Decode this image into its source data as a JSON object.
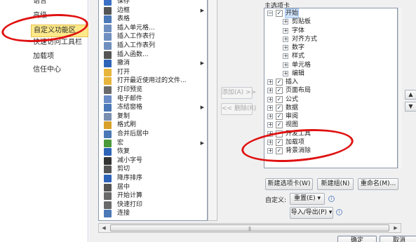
{
  "left_nav": {
    "items": [
      {
        "label": "语言"
      },
      {
        "label": "高级"
      },
      {
        "label": "自定义功能区"
      },
      {
        "label": "快速访问工具栏"
      },
      {
        "label": "加载项"
      },
      {
        "label": "信任中心"
      }
    ]
  },
  "commands": [
    {
      "label": "保存",
      "icon": "save-icon",
      "color": "#3a6fc4"
    },
    {
      "label": "边框",
      "icon": "border-icon",
      "color": "#555555",
      "arrow": true
    },
    {
      "label": "表格",
      "icon": "table-icon",
      "color": "#4b78b6"
    },
    {
      "label": "插入单元格...",
      "icon": "insert-cells-icon",
      "color": "#6f8fc0"
    },
    {
      "label": "插入工作表行",
      "icon": "insert-row-icon",
      "color": "#6f8fc0"
    },
    {
      "label": "插入工作表列",
      "icon": "insert-column-icon",
      "color": "#6f8fc0"
    },
    {
      "label": "插入函数...",
      "icon": "function-icon",
      "color": "#555555"
    },
    {
      "label": "撤消",
      "icon": "undo-icon",
      "color": "#2e64b8",
      "arrow": true
    },
    {
      "label": "打开",
      "icon": "open-folder-icon",
      "color": "#e8b53c"
    },
    {
      "label": "打开最近使用过的文件...",
      "icon": "recent-file-icon",
      "color": "#e8b53c"
    },
    {
      "label": "打印预览",
      "icon": "print-preview-icon",
      "color": "#6a6a6a"
    },
    {
      "label": "电子邮件",
      "icon": "email-icon",
      "color": "#6b8cc6"
    },
    {
      "label": "冻结窗格",
      "icon": "freeze-panes-icon",
      "color": "#4b78b6",
      "arrow": true
    },
    {
      "label": "复制",
      "icon": "copy-icon",
      "color": "#7a8fb0"
    },
    {
      "label": "格式刷",
      "icon": "format-painter-icon",
      "color": "#d8a02a"
    },
    {
      "label": "合并后居中",
      "icon": "merge-center-icon",
      "color": "#4b78b6"
    },
    {
      "label": "宏",
      "icon": "macro-icon",
      "color": "#4a9a3a",
      "arrow": true
    },
    {
      "label": "恢复",
      "icon": "redo-icon",
      "color": "#2e64b8"
    },
    {
      "label": "减小字号",
      "icon": "font-decrease-icon",
      "color": "#333333"
    },
    {
      "label": "剪切",
      "icon": "cut-icon",
      "color": "#555555"
    },
    {
      "label": "降序排序",
      "icon": "sort-desc-icon",
      "color": "#2e64b8"
    },
    {
      "label": "居中",
      "icon": "center-align-icon",
      "color": "#555555"
    },
    {
      "label": "开始计算",
      "icon": "calculate-icon",
      "color": "#6a6a6a"
    },
    {
      "label": "快速打印",
      "icon": "quick-print-icon",
      "color": "#6a6a6a"
    },
    {
      "label": "连接",
      "icon": "connections-icon",
      "color": "#4b78b6"
    }
  ],
  "buttons": {
    "add": "添加(A) >>",
    "remove": "<< 删除(R)",
    "new_tab": "新建选项卡(W)",
    "new_group": "新建组(N)",
    "rename": "重命名(M)...",
    "customize_label": "自定义:",
    "reset": "重置(E) ▾",
    "import_export": "导入/导出(P) ▾",
    "ok": "确定",
    "cancel": "取消"
  },
  "tree": {
    "header": "主选项卡",
    "nodes": [
      {
        "label": "开始",
        "level": 0,
        "expander": "⊟",
        "checked": true,
        "selected": true
      },
      {
        "label": "剪贴板",
        "level": 1,
        "expander": "⊞"
      },
      {
        "label": "字体",
        "level": 1,
        "expander": "⊞"
      },
      {
        "label": "对齐方式",
        "level": 1,
        "expander": "⊞"
      },
      {
        "label": "数字",
        "level": 1,
        "expander": "⊞"
      },
      {
        "label": "样式",
        "level": 1,
        "expander": "⊞"
      },
      {
        "label": "单元格",
        "level": 1,
        "expander": "⊞"
      },
      {
        "label": "编辑",
        "level": 1,
        "expander": "⊞"
      },
      {
        "label": "插入",
        "level": 0,
        "expander": "⊞",
        "checked": true
      },
      {
        "label": "页面布局",
        "level": 0,
        "expander": "⊞",
        "checked": true
      },
      {
        "label": "公式",
        "level": 0,
        "expander": "⊞",
        "checked": true
      },
      {
        "label": "数据",
        "level": 0,
        "expander": "⊞",
        "checked": true
      },
      {
        "label": "审阅",
        "level": 0,
        "expander": "⊞",
        "checked": true
      },
      {
        "label": "视图",
        "level": 0,
        "expander": "⊞",
        "checked": true
      },
      {
        "label": "开发工具",
        "level": 0,
        "expander": "⊞",
        "checked": false
      },
      {
        "label": "加载项",
        "level": 0,
        "expander": "⊞",
        "checked": true
      },
      {
        "label": "背景消除",
        "level": 0,
        "expander": "⊞",
        "checked": true
      }
    ]
  },
  "scroll": {
    "up_arrow": "▲",
    "down_arrow": "▼",
    "left_arrow": "◀",
    "right_arrow": "▶",
    "grip": "|||"
  },
  "annotation_color": "#e01212"
}
